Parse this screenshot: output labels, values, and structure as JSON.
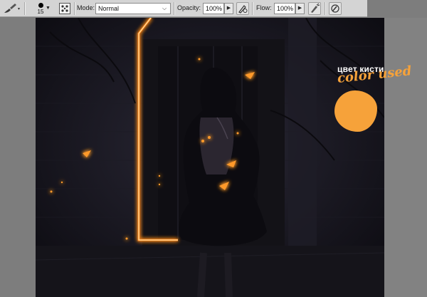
{
  "optionsBar": {
    "brushSize": "15",
    "modeLabel": "Mode:",
    "modeValue": "Normal",
    "opacityLabel": "Opacity:",
    "opacityValue": "100%",
    "flowLabel": "Flow:",
    "flowValue": "100%"
  },
  "annotation": {
    "russian": "цвет кисти",
    "english": "color used",
    "swatchColor": "#f6a23a"
  },
  "colors": {
    "glow": "#ff8a1a",
    "toolbarBg": "#d4d4d4"
  }
}
